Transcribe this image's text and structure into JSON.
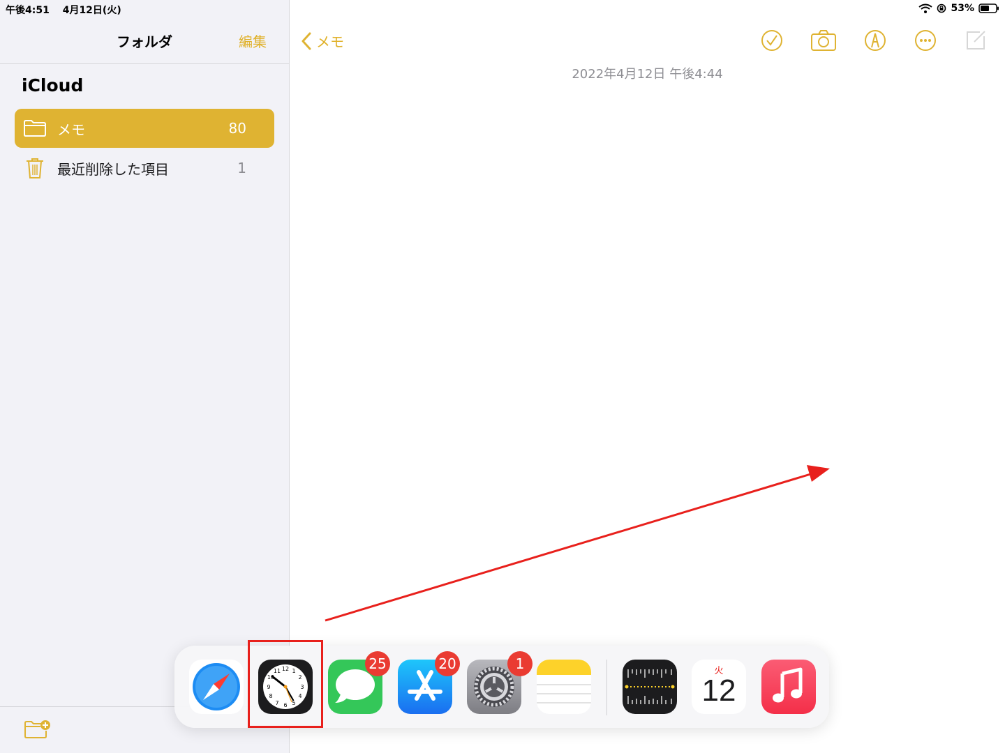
{
  "status_bar": {
    "time": "午後4:51",
    "date": "4月12日(火)",
    "battery": "53%"
  },
  "sidebar": {
    "title": "フォルダ",
    "edit_label": "編集",
    "section": "iCloud",
    "folders": [
      {
        "label": "メモ",
        "count": "80",
        "icon": "folder-icon",
        "selected": true
      },
      {
        "label": "最近削除した項目",
        "count": "1",
        "icon": "trash-icon",
        "selected": false
      }
    ]
  },
  "main": {
    "back_label": "メモ",
    "note_date": "2022年4月12日 午後4:44",
    "toolbar": [
      "checklist-icon",
      "camera-icon",
      "markup-icon",
      "more-icon",
      "compose-icon"
    ]
  },
  "dock": {
    "apps": [
      {
        "name": "Safari",
        "icon": "safari-icon"
      },
      {
        "name": "Clock",
        "icon": "clock-icon",
        "highlighted": true
      },
      {
        "name": "Messages",
        "icon": "messages-icon",
        "badge": "25"
      },
      {
        "name": "App Store",
        "icon": "app-store-icon",
        "badge": "20"
      },
      {
        "name": "Settings",
        "icon": "settings-icon",
        "badge": "1"
      },
      {
        "name": "Notes",
        "icon": "notes-icon"
      },
      {
        "name": "Measure",
        "icon": "measure-icon"
      },
      {
        "name": "Calendar",
        "icon": "calendar-icon",
        "day": "火",
        "date": "12"
      },
      {
        "name": "Music",
        "icon": "music-icon"
      }
    ]
  },
  "colors": {
    "accent": "#dfb332",
    "annotation": "#e8201c"
  }
}
